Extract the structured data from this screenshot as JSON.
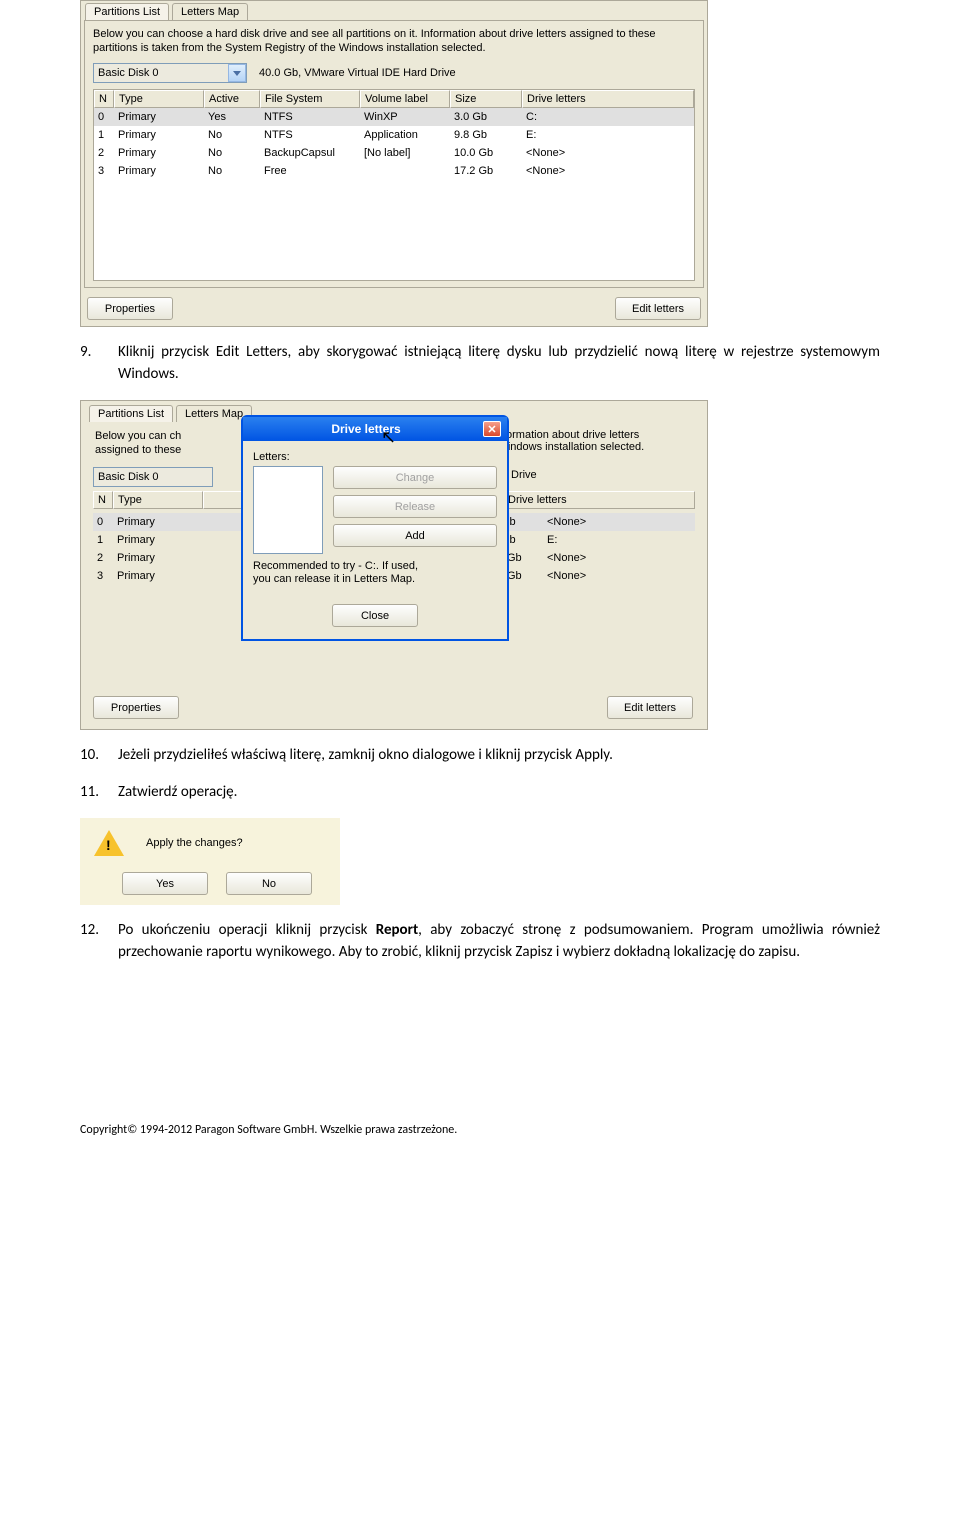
{
  "screenshot1": {
    "tabs": {
      "partitions": "Partitions List",
      "letters": "Letters Map"
    },
    "description": "Below you can choose a hard disk drive and see all partitions on it. Information about drive letters assigned to these partitions is taken from the System Registry of the Windows installation selected.",
    "combo": {
      "value": "Basic Disk 0",
      "side_text": "40.0 Gb, VMware Virtual IDE Hard Drive"
    },
    "headers": {
      "n": "N",
      "type": "Type",
      "active": "Active",
      "fs": "File System",
      "vol": "Volume label",
      "size": "Size",
      "drive": "Drive letters"
    },
    "rows": [
      {
        "n": "0",
        "type": "Primary",
        "active": "Yes",
        "fs": "NTFS",
        "vol": "WinXP",
        "size": "3.0 Gb",
        "drive": "C:"
      },
      {
        "n": "1",
        "type": "Primary",
        "active": "No",
        "fs": "NTFS",
        "vol": "Application",
        "size": "9.8 Gb",
        "drive": "E:"
      },
      {
        "n": "2",
        "type": "Primary",
        "active": "No",
        "fs": "BackupCapsul",
        "vol": "[No label]",
        "size": "10.0 Gb",
        "drive": "<None>"
      },
      {
        "n": "3",
        "type": "Primary",
        "active": "No",
        "fs": "Free",
        "vol": "",
        "size": "17.2 Gb",
        "drive": "<None>"
      }
    ],
    "buttons": {
      "properties": "Properties",
      "edit_letters": "Edit letters"
    }
  },
  "steps": {
    "s9_num": "9.",
    "s9": "Kliknij przycisk Edit Letters, aby skorygować istniejącą literę dysku lub przydzielić nową literę w rejestrze systemowym Windows.",
    "s10_num": "10.",
    "s10": "Jeżeli przydzieliłeś właściwą literę, zamknij okno dialogowe i kliknij przycisk Apply.",
    "s11_num": "11.",
    "s11": "Zatwierdź operację.",
    "s12_num": "12.",
    "s12_a": "Po ukończeniu operacji kliknij przycisk ",
    "s12_bold": "Report",
    "s12_b": ", aby zobaczyć stronę z podsumowaniem. Program umożliwia również przechowanie raportu wynikowego. Aby to zrobić, kliknij przycisk Zapisz i wybierz dokładną lokalizację do zapisu."
  },
  "screenshot2": {
    "tabs": {
      "partitions": "Partitions List",
      "letters": "Letters Map"
    },
    "desc_left": "Below you can ch\nassigned to these",
    "desc_right_1": "n it. Information about drive letters",
    "desc_right_2": "f the Windows installation selected.",
    "combo_value": "Basic Disk 0",
    "drive_text": "Drive",
    "headers": {
      "n": "N",
      "type": "Type",
      "drive": "Drive letters"
    },
    "rows": [
      {
        "n": "0",
        "type": "Primary",
        "gb": "ib",
        "drive": "<None>"
      },
      {
        "n": "1",
        "type": "Primary",
        "gb": "ib",
        "drive": "E:"
      },
      {
        "n": "2",
        "type": "Primary",
        "gb": "Gb",
        "drive": "<None>"
      },
      {
        "n": "3",
        "type": "Primary",
        "gb": "Gb",
        "drive": "<None>"
      }
    ],
    "properties": "Properties",
    "edit_letters": "Edit letters",
    "dialog": {
      "title": "Drive letters",
      "label": "Letters:",
      "change": "Change",
      "release": "Release",
      "add": "Add",
      "recommend": "Recommended to try - C:. If used, you can release it in Letters Map.",
      "close": "Close"
    }
  },
  "screenshot3": {
    "question": "Apply the changes?",
    "yes": "Yes",
    "no": "No"
  },
  "footer": "Copyright© 1994-2012 Paragon Software GmbH. Wszelkie prawa zastrzeżone."
}
